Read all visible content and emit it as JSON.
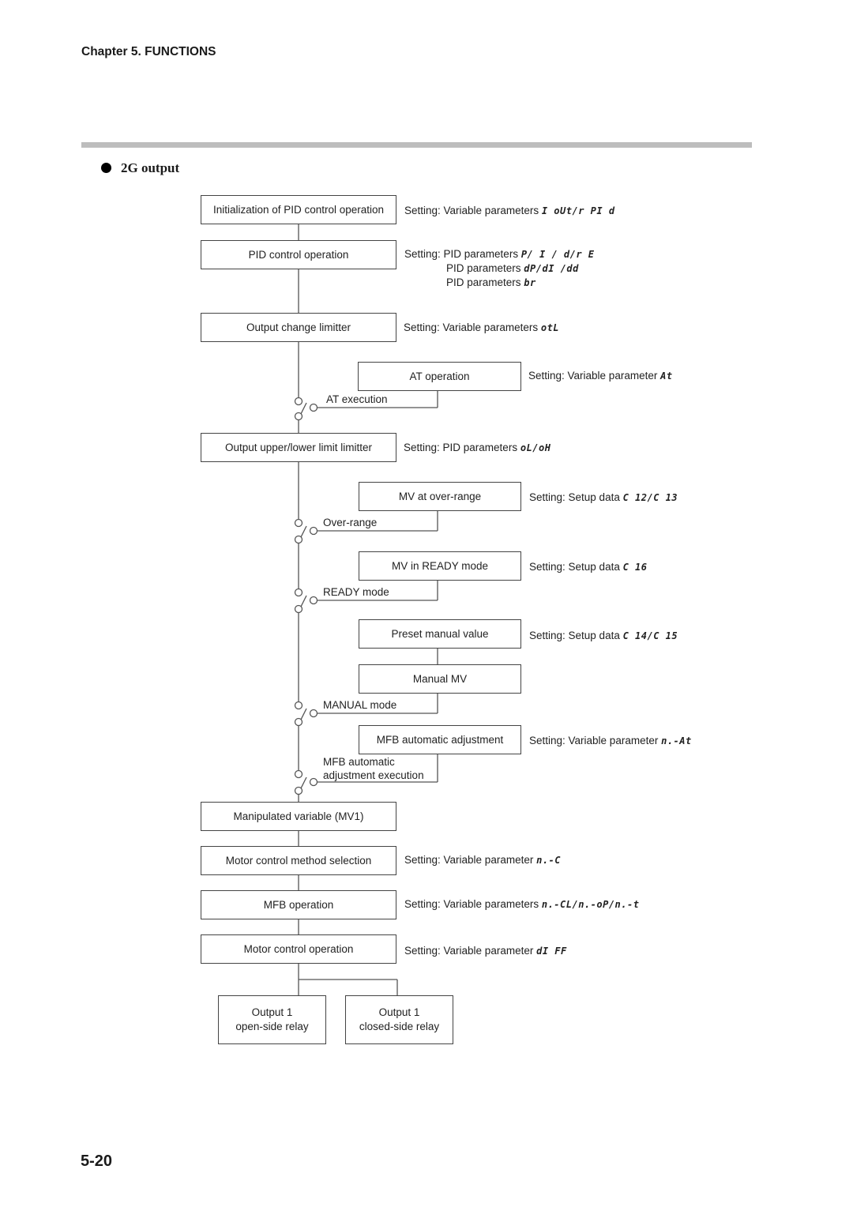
{
  "header": {
    "chapter": "Chapter 5. FUNCTIONS"
  },
  "section": {
    "bullet_icon": "filled-circle",
    "title": "2G output"
  },
  "footer": {
    "page_number": "5-20"
  },
  "diagram": {
    "main_boxes": {
      "init_pid": "Initialization of PID control operation",
      "pid_control": "PID control operation",
      "output_change_limiter": "Output change limitter",
      "output_limit_limiter": "Output upper/lower limit limitter",
      "mv1": "Manipulated variable (MV1)",
      "motor_method": "Motor control method selection",
      "mfb_operation": "MFB operation",
      "motor_control": "Motor control operation"
    },
    "side_boxes": {
      "at_operation": "AT operation",
      "mv_over_range": "MV at over-range",
      "mv_ready": "MV in READY mode",
      "preset_manual": "Preset manual value",
      "manual_mv": "Manual MV",
      "mfb_auto_adjust": "MFB automatic adjustment"
    },
    "switches": {
      "at_execution": "AT execution",
      "over_range": "Over-range",
      "ready_mode": "READY mode",
      "manual_mode": "MANUAL mode",
      "mfb_exec_line1": "MFB automatic",
      "mfb_exec_line2": "adjustment execution"
    },
    "outputs": {
      "open_line1": "Output 1",
      "open_line2": "open-side relay",
      "closed_line1": "Output 1",
      "closed_line2": "closed-side relay"
    },
    "settings": {
      "init_pid": {
        "prefix": "Setting: Variable parameters ",
        "code": "I oUt/r PI d"
      },
      "pid_1": {
        "prefix": "Setting: PID parameters ",
        "code": "P/ I / d/r E"
      },
      "pid_2": {
        "prefix": "PID parameters ",
        "code": "dP/dI /dd"
      },
      "pid_3": {
        "prefix": "PID parameters ",
        "code": "br"
      },
      "output_change": {
        "prefix": "Setting: Variable parameters ",
        "code": "otL"
      },
      "at": {
        "prefix": "Setting: Variable parameter ",
        "code": "At"
      },
      "output_limit": {
        "prefix": "Setting: PID parameters ",
        "code": "oL/oH"
      },
      "over_range": {
        "prefix": "Setting: Setup data ",
        "code": "C 12/C 13"
      },
      "ready": {
        "prefix": "Setting: Setup data ",
        "code": "C 16"
      },
      "preset_manual": {
        "prefix": "Setting: Setup data ",
        "code": "C 14/C 15"
      },
      "mfb_auto": {
        "prefix": "Setting: Variable parameter ",
        "code": "n.-At"
      },
      "motor_method": {
        "prefix": "Setting: Variable parameter ",
        "code": "n.-C"
      },
      "mfb_operation": {
        "prefix": "Setting: Variable parameters ",
        "code": "n.-CL/n.-oP/n.-t"
      },
      "motor_control": {
        "prefix": "Setting: Variable parameter ",
        "code": "dI FF"
      }
    }
  }
}
